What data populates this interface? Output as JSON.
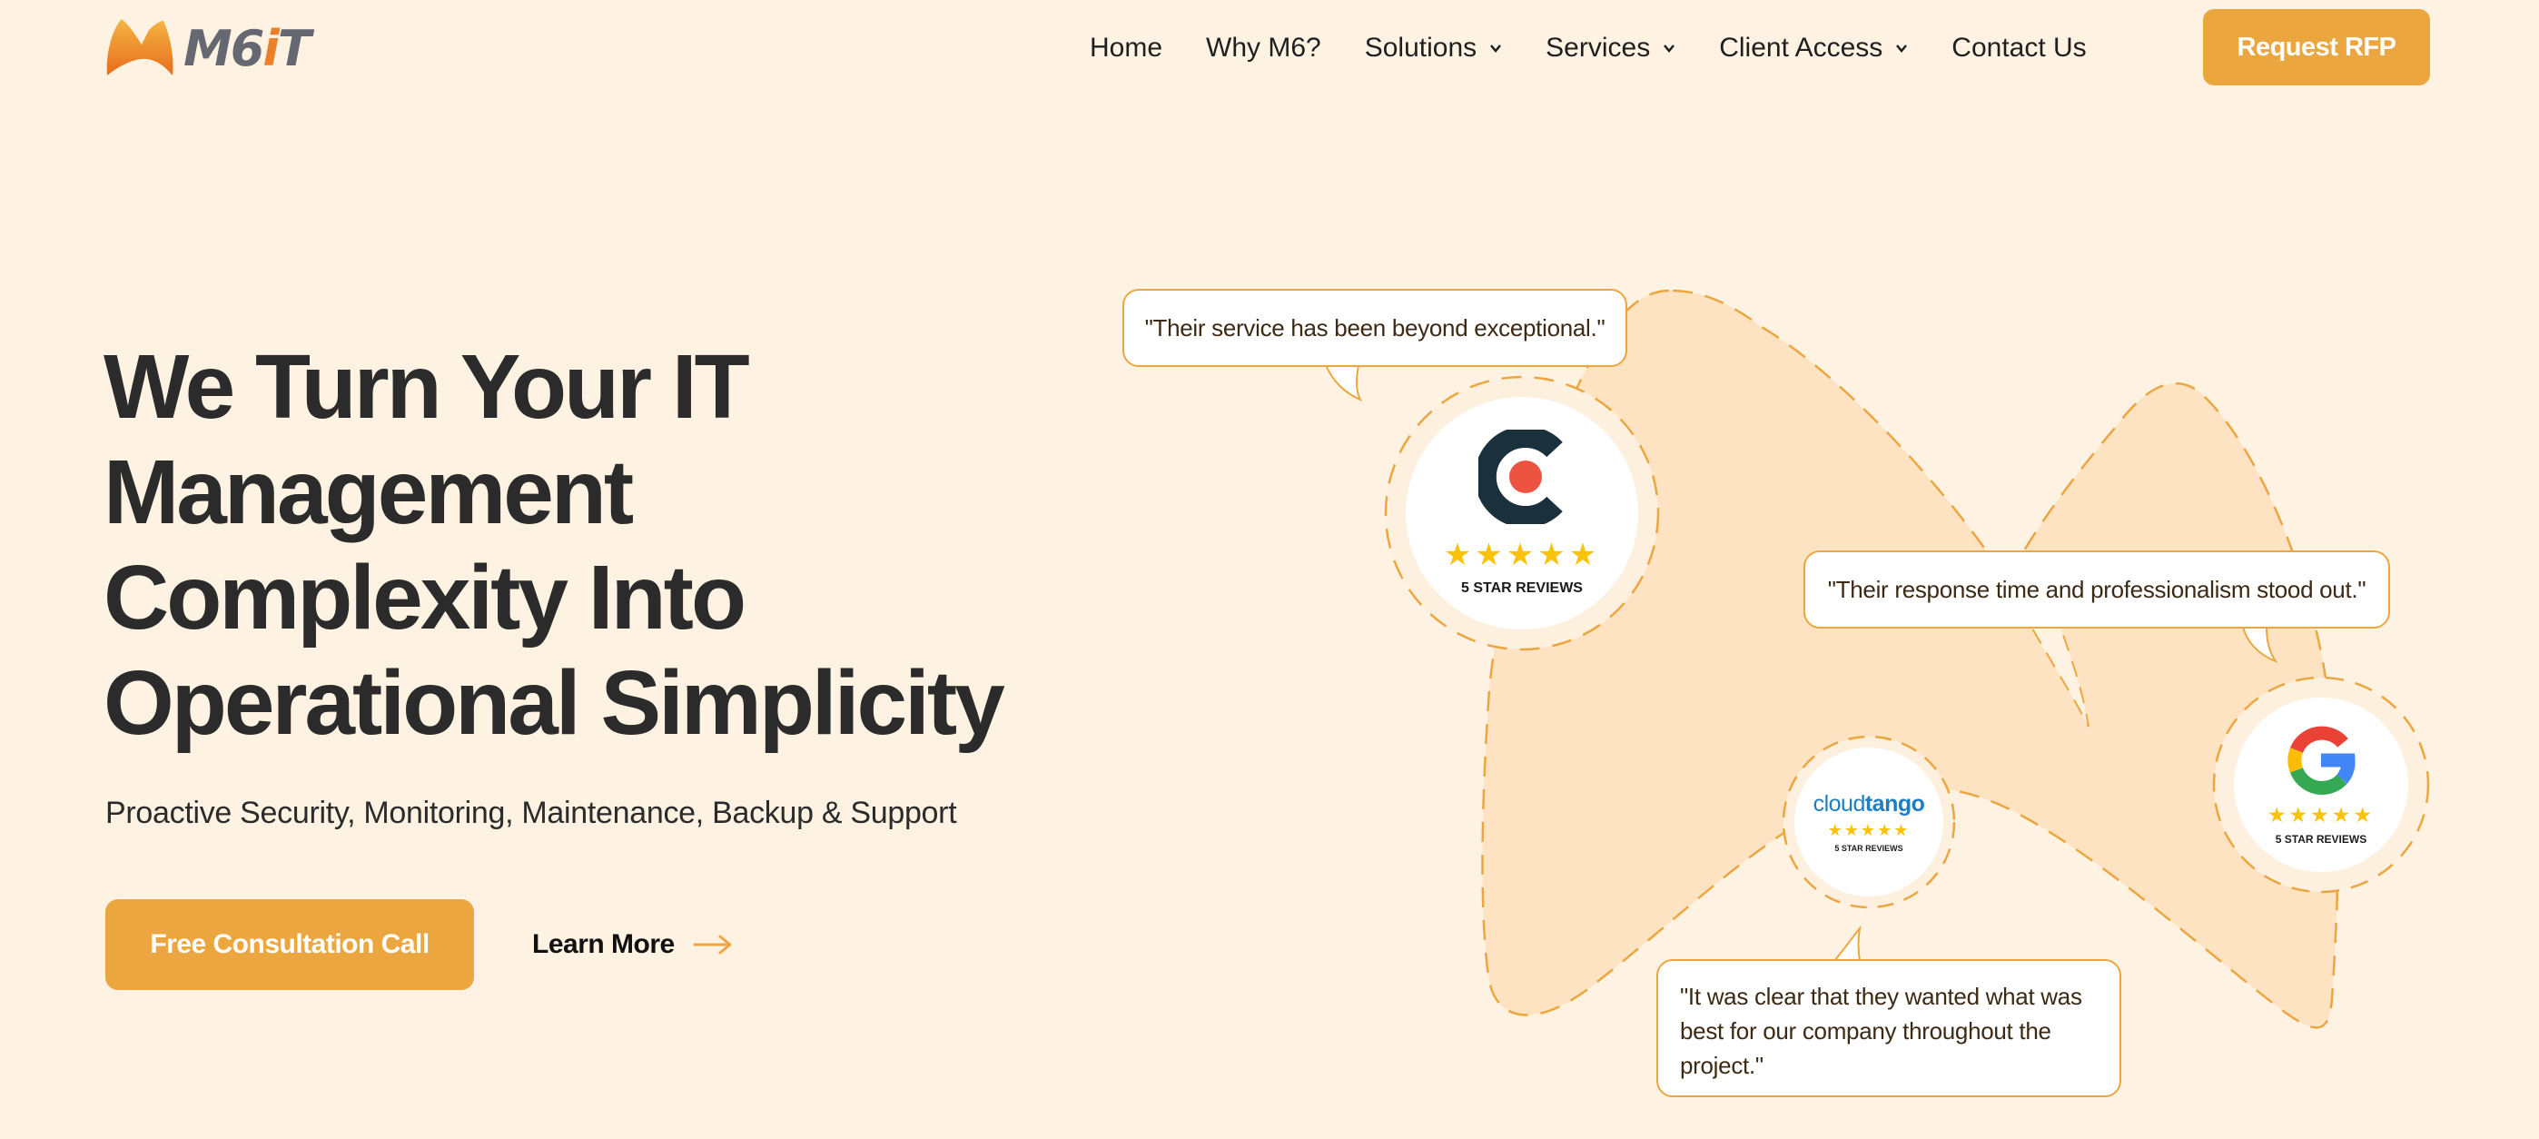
{
  "brand": {
    "name_main": "M6",
    "name_i": "i",
    "name_t": "T",
    "accent": "#eca640",
    "logo_orange": "#e9812a"
  },
  "nav": {
    "items": [
      {
        "label": "Home",
        "has_dropdown": false
      },
      {
        "label": "Why M6?",
        "has_dropdown": false
      },
      {
        "label": "Solutions",
        "has_dropdown": true
      },
      {
        "label": "Services",
        "has_dropdown": true
      },
      {
        "label": "Client Access",
        "has_dropdown": true
      },
      {
        "label": "Contact Us",
        "has_dropdown": false
      }
    ],
    "cta_label": "Request RFP"
  },
  "hero": {
    "title_lines": [
      "We Turn Your IT",
      "Management",
      "Complexity Into",
      "Operational Simplicity"
    ],
    "subtitle": "Proactive Security, Monitoring, Maintenance, Backup & Support",
    "primary_cta": "Free Consultation Call",
    "secondary_cta": "Learn More"
  },
  "testimonials": [
    {
      "quote": "\"Their service has been beyond exceptional.\""
    },
    {
      "quote": "\"Their response time and professionalism stood out.\""
    },
    {
      "quote": "\"It was clear that they wanted what was best for our company throughout the project.\""
    }
  ],
  "review_badges": [
    {
      "platform": "clutch",
      "stars": 5,
      "stars_text": "★★★★★",
      "label": "5 STAR REVIEWS"
    },
    {
      "platform": "cloudtango",
      "logo_part1": "cloud",
      "logo_part2": "tango",
      "stars": 5,
      "stars_text": "★★★★★",
      "label": "5 STAR REVIEWS"
    },
    {
      "platform": "google",
      "stars": 5,
      "stars_text": "★★★★★",
      "label": "5 STAR REVIEWS"
    }
  ]
}
